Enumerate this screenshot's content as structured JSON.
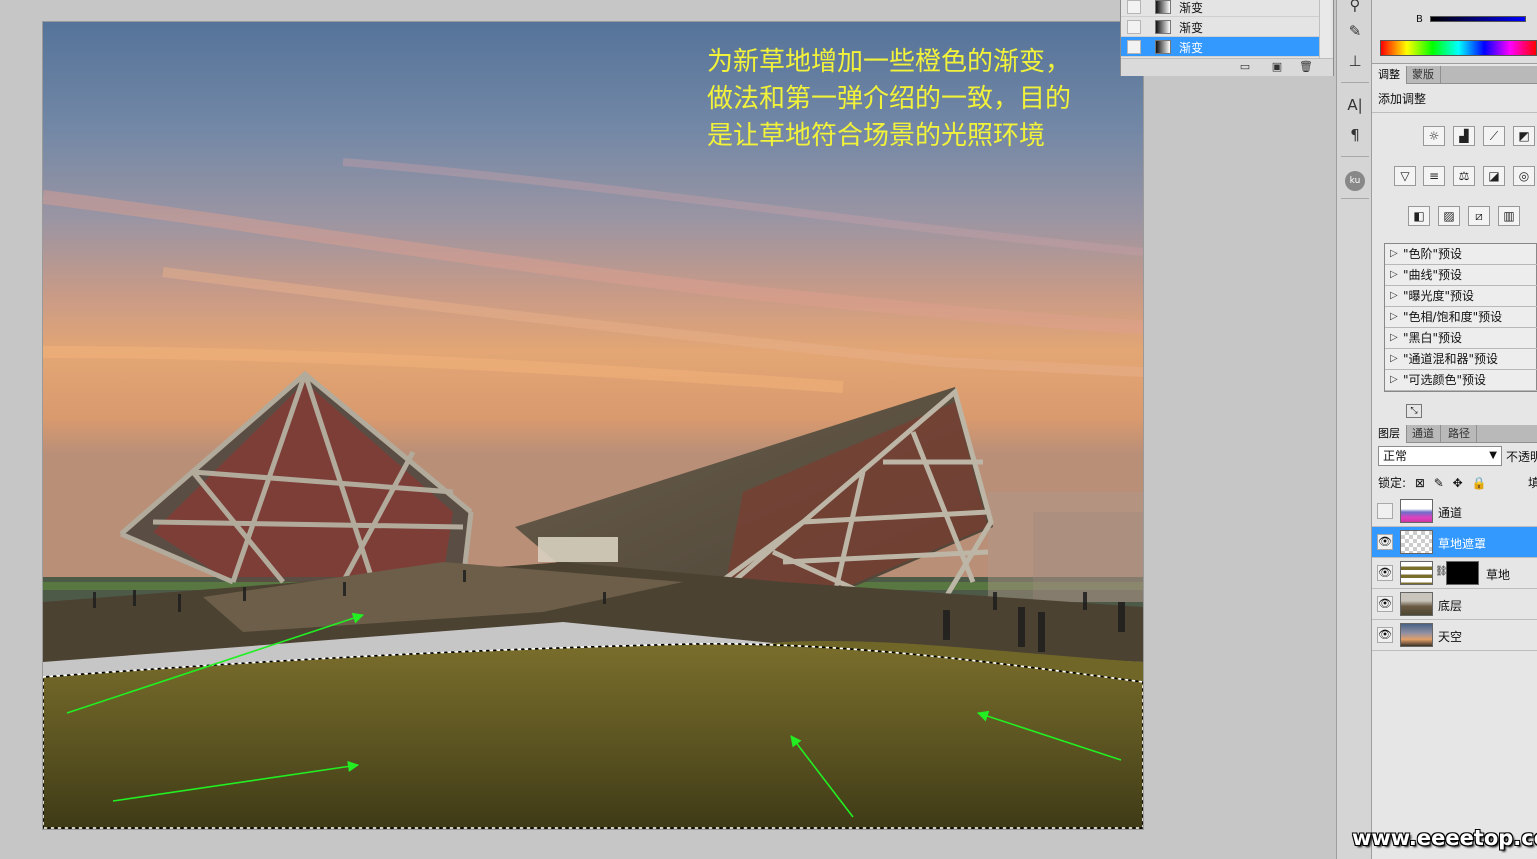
{
  "annotation": {
    "lines": [
      "为新草地增加一些橙色的渐变，",
      "做法和第一弹介绍的一致，目的",
      "是让草地符合场景的光照环境"
    ]
  },
  "gradient_panel": {
    "items": [
      {
        "label": "渐变",
        "active": false
      },
      {
        "label": "渐变",
        "active": false
      },
      {
        "label": "渐变",
        "active": true
      }
    ]
  },
  "color_panel": {
    "b_label": "B"
  },
  "adjust_panel": {
    "tabs": [
      "调整",
      "蒙版"
    ],
    "title": "添加调整",
    "presets": [
      "\"色阶\"预设",
      "\"曲线\"预设",
      "\"曝光度\"预设",
      "\"色相/饱和度\"预设",
      "\"黑白\"预设",
      "\"通道混和器\"预设",
      "\"可选颜色\"预设"
    ]
  },
  "layers_panel": {
    "tabs": [
      "图层",
      "通道",
      "路径"
    ],
    "blend_mode": "正常",
    "opacity_label": "不透明",
    "lock_label": "锁定:",
    "fill_label": "填",
    "layers": [
      {
        "name": "通道",
        "visible": false,
        "active": false
      },
      {
        "name": "草地遮罩",
        "visible": true,
        "active": true
      },
      {
        "name": "草地",
        "visible": true,
        "active": false
      },
      {
        "name": "底层",
        "visible": true,
        "active": false
      },
      {
        "name": "天空",
        "visible": true,
        "active": false
      }
    ]
  },
  "tools": {
    "text_tool": "A|",
    "paragraph_tool": "¶",
    "kuler": "ku"
  },
  "watermark": "www.eeeetop.com",
  "colors": {
    "annotation": "#f2f23a",
    "selection_highlight": "#3399ff",
    "arrow": "#22ee22"
  }
}
